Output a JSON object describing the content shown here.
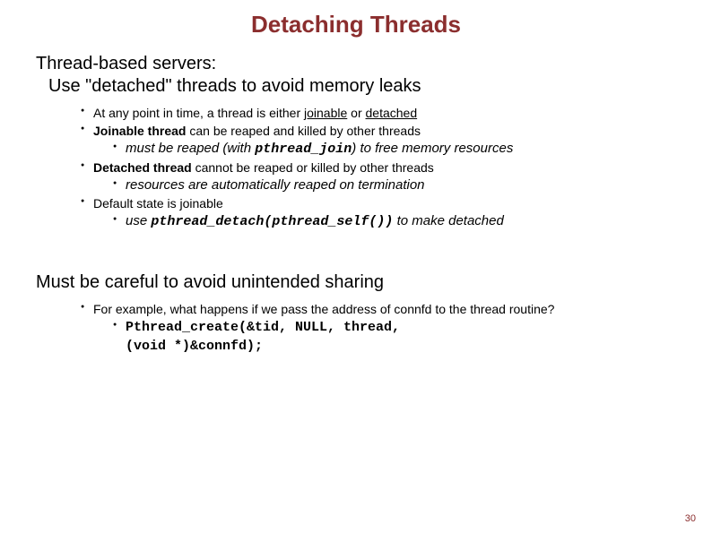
{
  "title": "Detaching Threads",
  "section1": {
    "line1": "Thread-based servers:",
    "line2": "Use \"detached\" threads to avoid memory leaks",
    "items": {
      "i1": {
        "pre": "At any point in time, a thread is either ",
        "u1": "joinable",
        "mid": " or ",
        "u2": "detached"
      },
      "i2": {
        "bold": "Joinable thread",
        "rest": " can be reaped and killed by other threads",
        "sub": {
          "pre": "must be reaped (with ",
          "code": "pthread_join",
          "post": ") to free memory resources"
        }
      },
      "i3": {
        "bold": "Detached thread",
        "rest": " cannot be reaped or killed by other threads",
        "sub": "resources are automatically reaped on termination"
      },
      "i4": {
        "text": "Default state is joinable",
        "sub": {
          "pre": "use ",
          "code": "pthread_detach(pthread_self())",
          "post": " to make detached"
        }
      }
    }
  },
  "section2": {
    "line1": "Must be careful to avoid unintended sharing",
    "items": {
      "i1": {
        "text": "For example, what happens if we pass the address of connfd to the thread routine?",
        "sub": {
          "l1": "Pthread_create(&tid, NULL, thread,",
          "l2": "(void *)&connfd);"
        }
      }
    }
  },
  "pagenum": "30"
}
